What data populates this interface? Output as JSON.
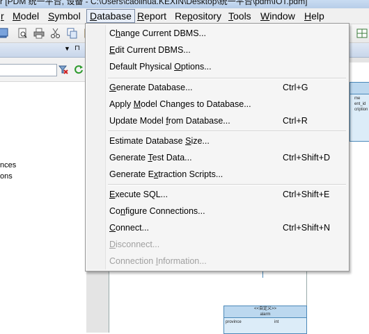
{
  "window": {
    "title": "r [PDM 统一平台, 设备 - C:\\Users\\caolihua.KEXIN\\Desktop\\统一平台\\pdm\\IOT.pdm]"
  },
  "menubar": {
    "items": [
      {
        "before": "",
        "key": "r",
        "after": ""
      },
      {
        "before": "",
        "key": "M",
        "after": "odel"
      },
      {
        "before": "",
        "key": "S",
        "after": "ymbol"
      },
      {
        "before": "",
        "key": "D",
        "after": "atabase"
      },
      {
        "before": "",
        "key": "R",
        "after": "eport"
      },
      {
        "before": "Re",
        "key": "p",
        "after": "ository"
      },
      {
        "before": "",
        "key": "T",
        "after": "ools"
      },
      {
        "before": "",
        "key": "W",
        "after": "indow"
      },
      {
        "before": "",
        "key": "H",
        "after": "elp"
      }
    ]
  },
  "panel": {
    "header_icons": [
      "▼",
      "⊓"
    ],
    "search_value": "",
    "tree_items": [
      "nces",
      "ons"
    ]
  },
  "diagram": {
    "table_top": {
      "lines": [
        "me",
        "ent_id",
        "cription"
      ]
    },
    "table_bottom": {
      "title_1": "<<自定义>>",
      "title_2": "alarm",
      "col_1": "province",
      "col_2": "int"
    }
  },
  "database_menu": {
    "items": [
      {
        "before": "C",
        "key": "h",
        "after": "ange Current DBMS...",
        "shortcut": "",
        "enabled": true
      },
      {
        "before": "",
        "key": "E",
        "after": "dit Current DBMS...",
        "shortcut": "",
        "enabled": true
      },
      {
        "before": "Default Physical ",
        "key": "O",
        "after": "ptions...",
        "shortcut": "",
        "enabled": true
      },
      {
        "before": "",
        "key": "G",
        "after": "enerate Database...",
        "shortcut": "Ctrl+G",
        "enabled": true
      },
      {
        "before": "Apply ",
        "key": "M",
        "after": "odel Changes to Database...",
        "shortcut": "",
        "enabled": true
      },
      {
        "before": "Update Model ",
        "key": "f",
        "after": "rom Database...",
        "shortcut": "Ctrl+R",
        "enabled": true
      },
      {
        "before": "Estimate Database ",
        "key": "S",
        "after": "ize...",
        "shortcut": "",
        "enabled": true
      },
      {
        "before": "Generate ",
        "key": "T",
        "after": "est Data...",
        "shortcut": "Ctrl+Shift+D",
        "enabled": true
      },
      {
        "before": "Generate E",
        "key": "x",
        "after": "traction Scripts...",
        "shortcut": "",
        "enabled": true
      },
      {
        "before": "",
        "key": "E",
        "after": "xecute SQL...",
        "shortcut": "Ctrl+Shift+E",
        "enabled": true
      },
      {
        "before": "Co",
        "key": "n",
        "after": "figure Connections...",
        "shortcut": "",
        "enabled": true
      },
      {
        "before": "",
        "key": "C",
        "after": "onnect...",
        "shortcut": "Ctrl+Shift+N",
        "enabled": true
      },
      {
        "before": "",
        "key": "D",
        "after": "isconnect...",
        "shortcut": "",
        "enabled": false
      },
      {
        "before": "Connection ",
        "key": "I",
        "after": "nformation...",
        "shortcut": "",
        "enabled": false
      }
    ]
  },
  "colors": {
    "menu_bg": "#f5f5f5",
    "disabled_text": "#a0a0a0",
    "table_fill": "#dcecf8",
    "table_border": "#4a88b8"
  }
}
